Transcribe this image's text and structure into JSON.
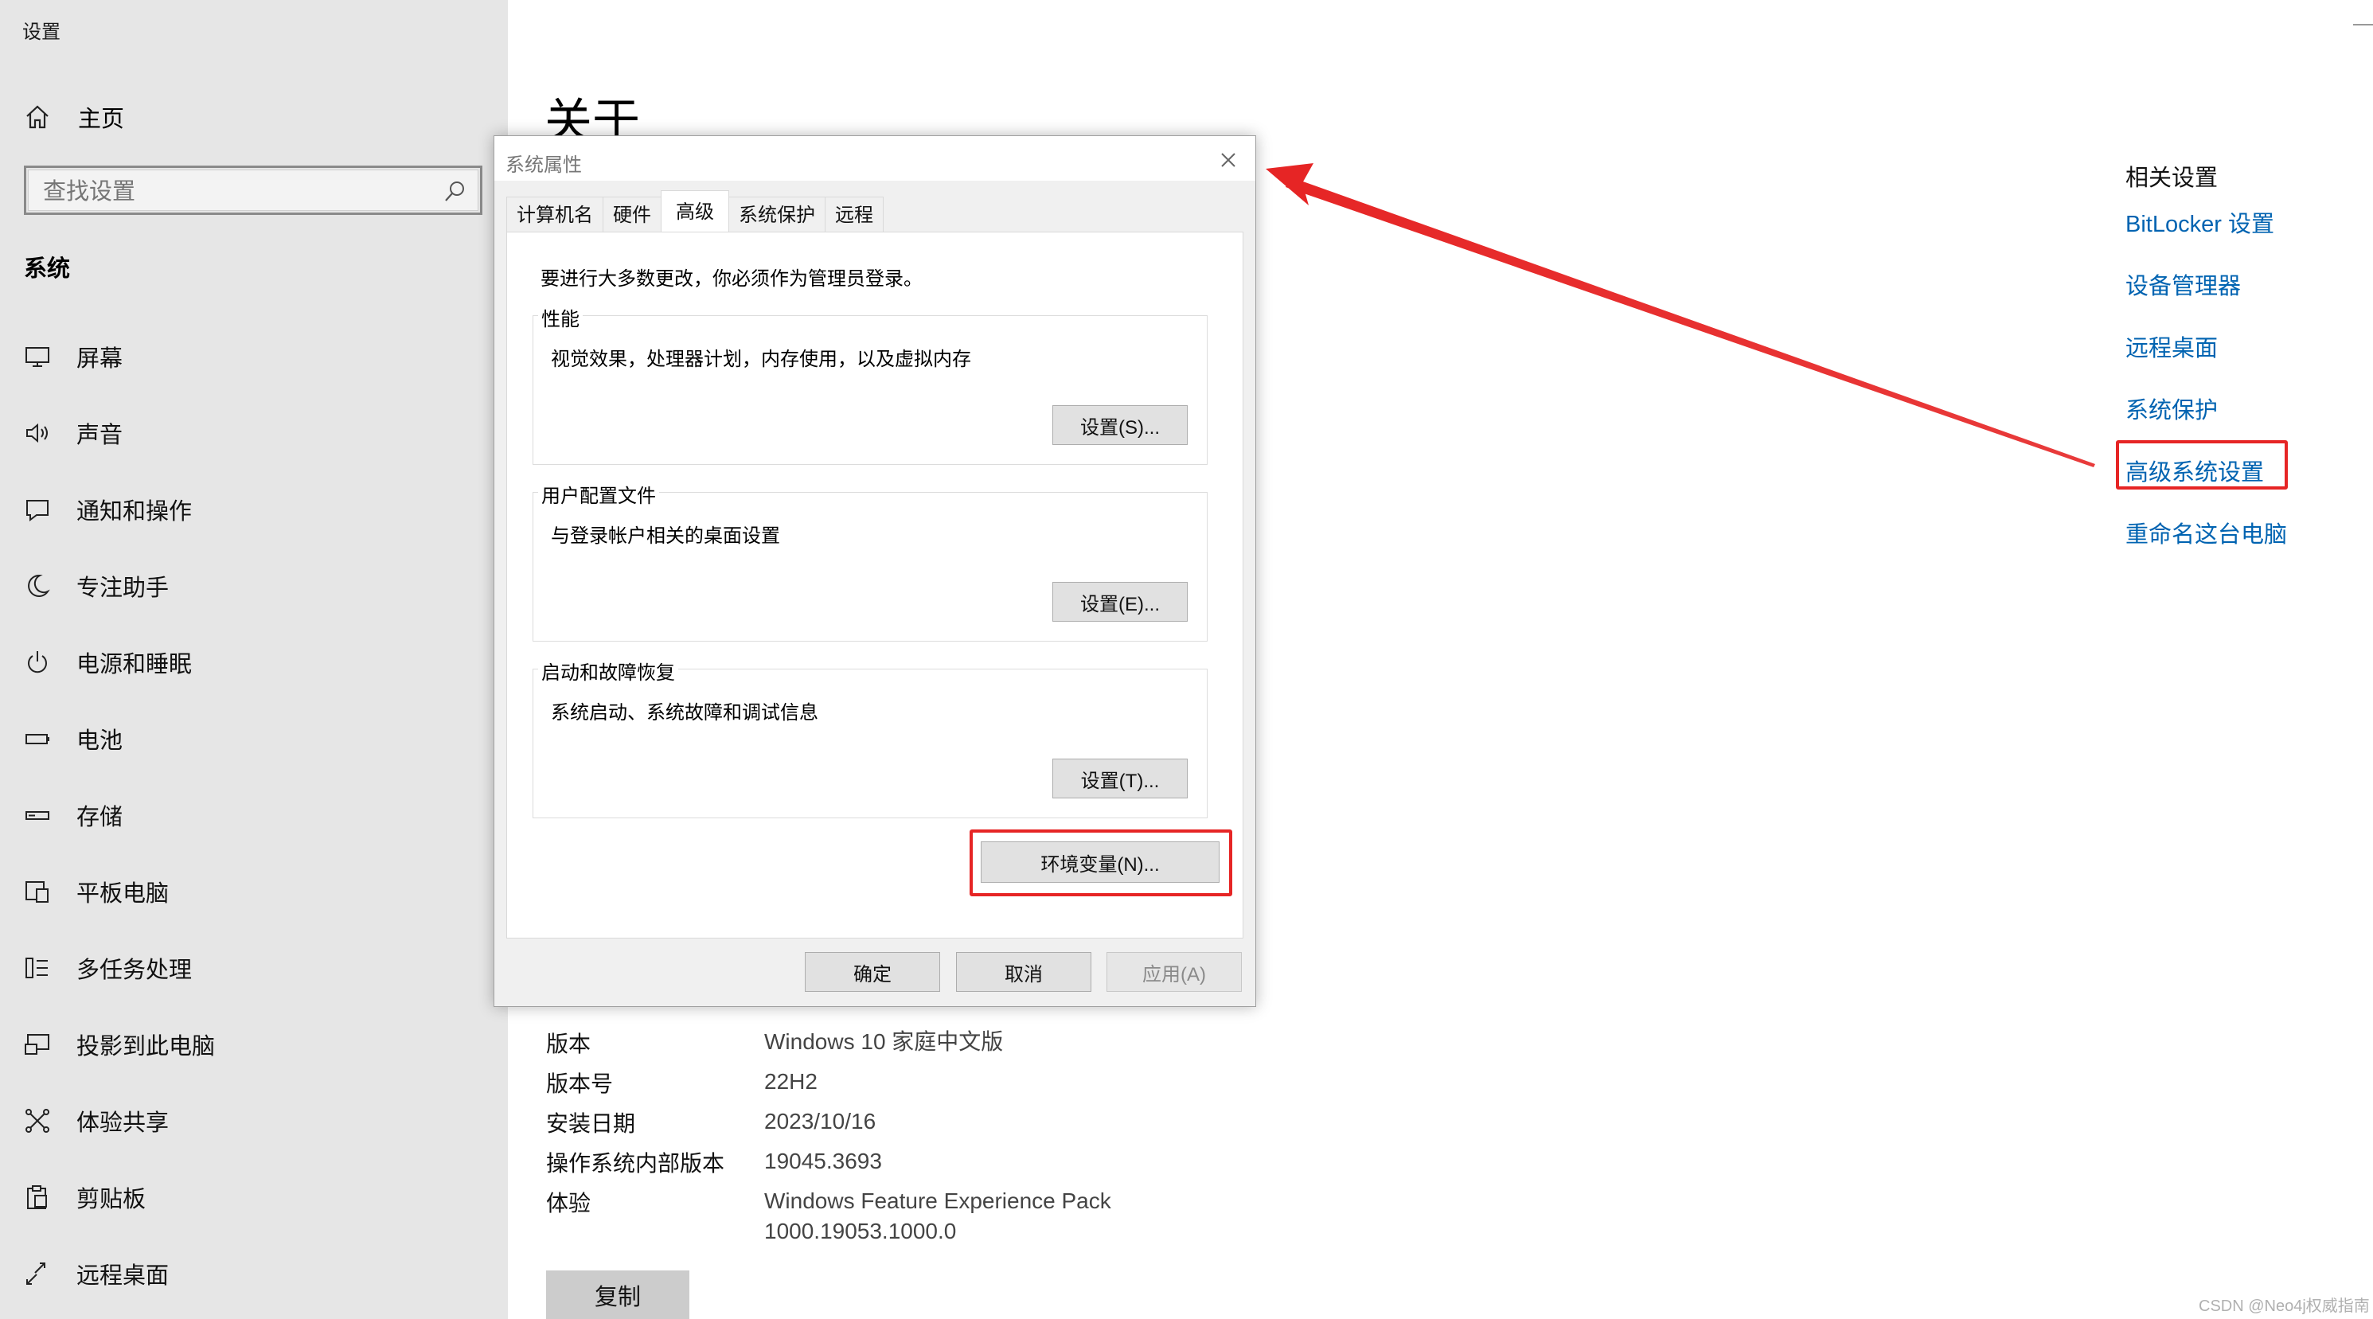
{
  "app": {
    "title": "设置"
  },
  "sidebar": {
    "home_label": "主页",
    "search_placeholder": "查找设置",
    "section_title": "系统",
    "items": [
      {
        "label": "屏幕",
        "icon": "monitor-icon"
      },
      {
        "label": "声音",
        "icon": "speaker-icon"
      },
      {
        "label": "通知和操作",
        "icon": "notification-icon"
      },
      {
        "label": "专注助手",
        "icon": "moon-icon"
      },
      {
        "label": "电源和睡眠",
        "icon": "power-icon"
      },
      {
        "label": "电池",
        "icon": "battery-icon"
      },
      {
        "label": "存储",
        "icon": "storage-icon"
      },
      {
        "label": "平板电脑",
        "icon": "tablet-icon"
      },
      {
        "label": "多任务处理",
        "icon": "multitask-icon"
      },
      {
        "label": "投影到此电脑",
        "icon": "project-icon"
      },
      {
        "label": "体验共享",
        "icon": "share-icon"
      },
      {
        "label": "剪贴板",
        "icon": "clipboard-icon"
      },
      {
        "label": "远程桌面",
        "icon": "remote-icon"
      }
    ]
  },
  "main": {
    "page_title": "关于",
    "related": {
      "title": "相关设置",
      "links": [
        "BitLocker 设置",
        "设备管理器",
        "远程桌面",
        "系统保护",
        "高级系统设置",
        "重命名这台电脑"
      ]
    },
    "specs": [
      {
        "key": "版本",
        "value": "Windows 10 家庭中文版"
      },
      {
        "key": "版本号",
        "value": "22H2"
      },
      {
        "key": "安装日期",
        "value": "2023/10/16"
      },
      {
        "key": "操作系统内部版本",
        "value": "19045.3693"
      },
      {
        "key": "体验",
        "value": "Windows Feature Experience Pack",
        "value2": "1000.19053.1000.0"
      }
    ],
    "copy_label": "复制"
  },
  "dialog": {
    "title": "系统属性",
    "tabs": [
      "计算机名",
      "硬件",
      "高级",
      "系统保护",
      "远程"
    ],
    "active_tab": "高级",
    "admin_note": "要进行大多数更改，你必须作为管理员登录。",
    "groups": [
      {
        "label": "性能",
        "desc": "视觉效果，处理器计划，内存使用，以及虚拟内存",
        "button": "设置(S)..."
      },
      {
        "label": "用户配置文件",
        "desc": "与登录帐户相关的桌面设置",
        "button": "设置(E)..."
      },
      {
        "label": "启动和故障恢复",
        "desc": "系统启动、系统故障和调试信息",
        "button": "设置(T)..."
      }
    ],
    "env_button": "环境变量(N)...",
    "ok": "确定",
    "cancel": "取消",
    "apply": "应用(A)"
  },
  "annotations": {
    "highlight_color": "#e62525"
  },
  "colors": {
    "link": "#0063b1",
    "sidebar_bg": "#e6e6e6",
    "dialog_bg": "#f0f0f0"
  },
  "watermark": "CSDN @Neo4j权威指南"
}
